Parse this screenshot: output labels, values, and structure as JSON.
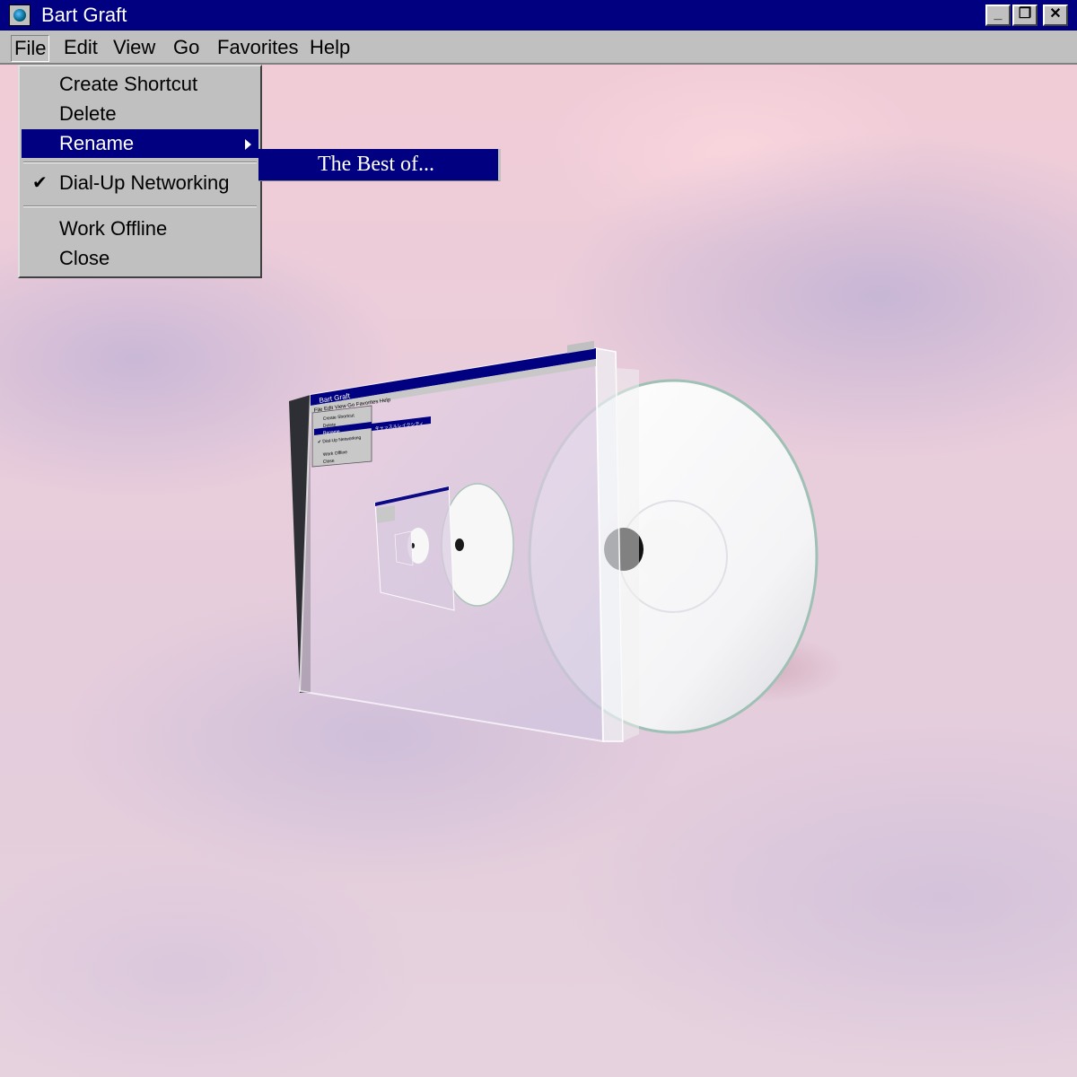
{
  "window": {
    "title": "Bart Graft",
    "minimize_label": "_",
    "maximize_label": "❐",
    "close_label": "✕"
  },
  "menubar": {
    "items": [
      {
        "label": "File"
      },
      {
        "label": "Edit"
      },
      {
        "label": "View"
      },
      {
        "label": "Go"
      },
      {
        "label": "Favorites"
      },
      {
        "label": "Help"
      }
    ]
  },
  "file_menu": {
    "items": [
      {
        "label": "Create Shortcut"
      },
      {
        "label": "Delete"
      },
      {
        "label": "Rename"
      },
      {
        "label": "Dial-Up Networking",
        "checked": true
      },
      {
        "label": "Work Offline"
      },
      {
        "label": "Close"
      }
    ],
    "check_glyph": "✔",
    "rename_submenu": {
      "label": "The Best of..."
    }
  },
  "cd_case": {
    "window_title": "Bart Graft",
    "menu_labels": [
      "File",
      "Edit",
      "View",
      "Go",
      "Favorites",
      "Help"
    ],
    "menu_items": [
      "Create Shortcut",
      "Delete",
      "Rename",
      "Dial-Up Networking",
      "Work Offline",
      "Close"
    ],
    "submenu_text": "キャッスルレイクシティ"
  },
  "colors": {
    "titlebar": "#000080",
    "menu_face": "#c0c0c0",
    "highlight": "#000080",
    "sky_pink": "#f2ccd6",
    "sky_lavender": "#c4b4d6"
  },
  "icons": {
    "app": "globe-icon",
    "check": "checkmark-icon",
    "submenu_arrow": "triangle-right-icon"
  }
}
